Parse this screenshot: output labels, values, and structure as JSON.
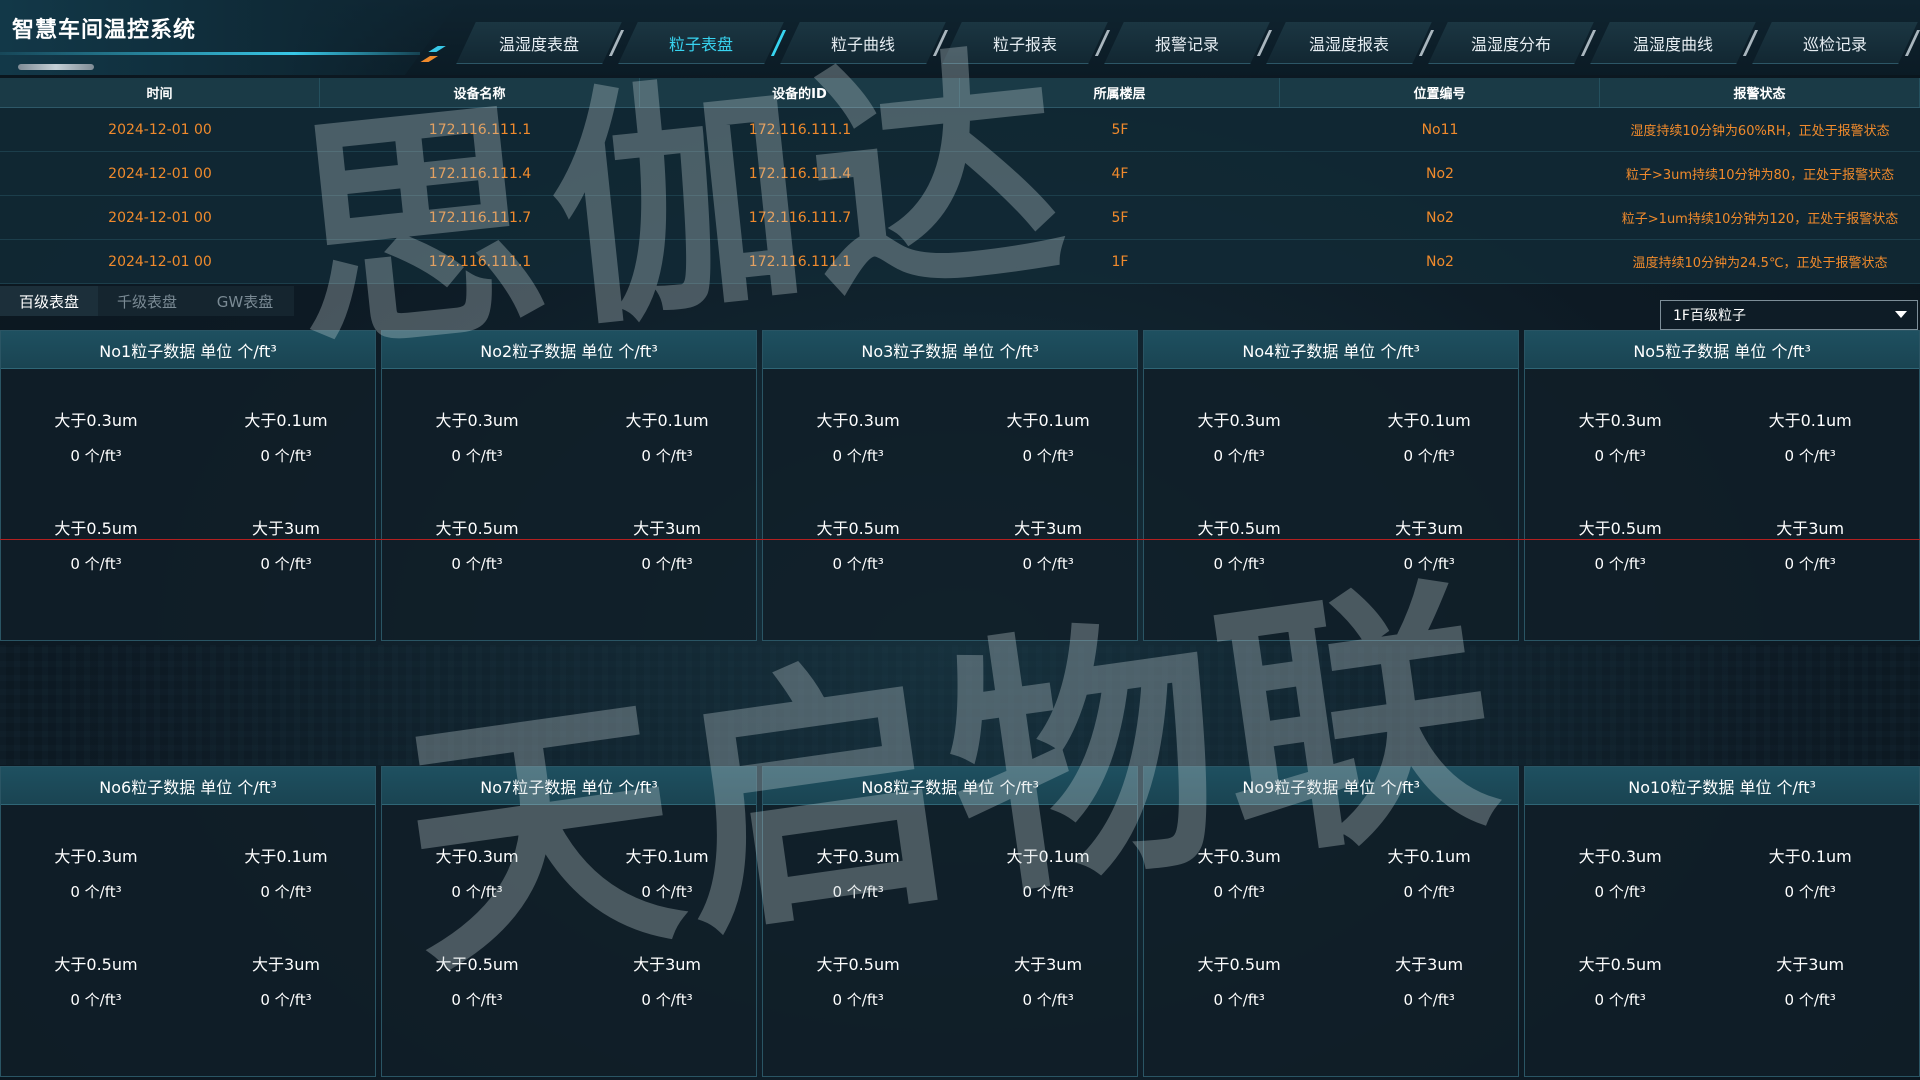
{
  "app": {
    "title": "智慧车间温控系统",
    "colors": {
      "accent": "#38d4f0",
      "alarm": "#f08a2c",
      "panel_header": "#1e5060"
    }
  },
  "tabs": [
    {
      "label": "温湿度表盘",
      "active": false
    },
    {
      "label": "粒子表盘",
      "active": true
    },
    {
      "label": "粒子曲线",
      "active": false
    },
    {
      "label": "粒子报表",
      "active": false
    },
    {
      "label": "报警记录",
      "active": false
    },
    {
      "label": "温湿度报表",
      "active": false
    },
    {
      "label": "温湿度分布",
      "active": false
    },
    {
      "label": "温湿度曲线",
      "active": false
    },
    {
      "label": "巡检记录",
      "active": false
    }
  ],
  "alarm_table": {
    "columns": [
      "时间",
      "设备名称",
      "设备的ID",
      "所属楼层",
      "位置编号",
      "报警状态"
    ],
    "rows": [
      [
        "2024-12-01 00",
        "172.116.111.1",
        "172.116.111.1",
        "5F",
        "No11",
        "湿度持续10分钟为60%RH，正处于报警状态"
      ],
      [
        "2024-12-01 00",
        "172.116.111.4",
        "172.116.111.4",
        "4F",
        "No2",
        "粒子>3um持续10分钟为80，正处于报警状态"
      ],
      [
        "2024-12-01 00",
        "172.116.111.7",
        "172.116.111.7",
        "5F",
        "No2",
        "粒子>1um持续10分钟为120，正处于报警状态"
      ],
      [
        "2024-12-01 00",
        "172.116.111.1",
        "172.116.111.1",
        "1F",
        "No2",
        "温度持续10分钟为24.5℃，正处于报警状态"
      ]
    ]
  },
  "subtabs": [
    {
      "label": "百级表盘",
      "active": true
    },
    {
      "label": "千级表盘",
      "active": false
    },
    {
      "label": "GW表盘",
      "active": false
    }
  ],
  "floor_select": {
    "value": "1F百级粒子"
  },
  "cards": [
    {
      "title": "No1粒子数据 单位 个/ft³",
      "cells": [
        [
          "大于0.3um",
          "0 个/ft³"
        ],
        [
          "大于0.1um",
          "0 个/ft³"
        ],
        [
          "大于0.5um",
          "0 个/ft³"
        ],
        [
          "大于3um",
          "0 个/ft³"
        ]
      ]
    },
    {
      "title": "No2粒子数据 单位 个/ft³",
      "cells": [
        [
          "大于0.3um",
          "0 个/ft³"
        ],
        [
          "大于0.1um",
          "0 个/ft³"
        ],
        [
          "大于0.5um",
          "0 个/ft³"
        ],
        [
          "大于3um",
          "0 个/ft³"
        ]
      ]
    },
    {
      "title": "No3粒子数据 单位 个/ft³",
      "cells": [
        [
          "大于0.3um",
          "0 个/ft³"
        ],
        [
          "大于0.1um",
          "0 个/ft³"
        ],
        [
          "大于0.5um",
          "0 个/ft³"
        ],
        [
          "大于3um",
          "0 个/ft³"
        ]
      ]
    },
    {
      "title": "No4粒子数据 单位 个/ft³",
      "cells": [
        [
          "大于0.3um",
          "0 个/ft³"
        ],
        [
          "大于0.1um",
          "0 个/ft³"
        ],
        [
          "大于0.5um",
          "0 个/ft³"
        ],
        [
          "大于3um",
          "0 个/ft³"
        ]
      ]
    },
    {
      "title": "No5粒子数据 单位 个/ft³",
      "cells": [
        [
          "大于0.3um",
          "0 个/ft³"
        ],
        [
          "大于0.1um",
          "0 个/ft³"
        ],
        [
          "大于0.5um",
          "0 个/ft³"
        ],
        [
          "大于3um",
          "0 个/ft³"
        ]
      ]
    },
    {
      "title": "No6粒子数据 单位 个/ft³",
      "cells": [
        [
          "大于0.3um",
          "0 个/ft³"
        ],
        [
          "大于0.1um",
          "0 个/ft³"
        ],
        [
          "大于0.5um",
          "0 个/ft³"
        ],
        [
          "大于3um",
          "0 个/ft³"
        ]
      ]
    },
    {
      "title": "No7粒子数据 单位 个/ft³",
      "cells": [
        [
          "大于0.3um",
          "0 个/ft³"
        ],
        [
          "大于0.1um",
          "0 个/ft³"
        ],
        [
          "大于0.5um",
          "0 个/ft³"
        ],
        [
          "大于3um",
          "0 个/ft³"
        ]
      ]
    },
    {
      "title": "No8粒子数据 单位 个/ft³",
      "cells": [
        [
          "大于0.3um",
          "0 个/ft³"
        ],
        [
          "大于0.1um",
          "0 个/ft³"
        ],
        [
          "大于0.5um",
          "0 个/ft³"
        ],
        [
          "大于3um",
          "0 个/ft³"
        ]
      ]
    },
    {
      "title": "No9粒子数据 单位 个/ft³",
      "cells": [
        [
          "大于0.3um",
          "0 个/ft³"
        ],
        [
          "大于0.1um",
          "0 个/ft³"
        ],
        [
          "大于0.5um",
          "0 个/ft³"
        ],
        [
          "大于3um",
          "0 个/ft³"
        ]
      ]
    },
    {
      "title": "No10粒子数据 单位 个/ft³",
      "cells": [
        [
          "大于0.3um",
          "0 个/ft³"
        ],
        [
          "大于0.1um",
          "0 个/ft³"
        ],
        [
          "大于0.5um",
          "0 个/ft³"
        ],
        [
          "大于3um",
          "0 个/ft³"
        ]
      ]
    }
  ],
  "watermark": {
    "line1": "思伽达",
    "line2": "天启物联"
  }
}
